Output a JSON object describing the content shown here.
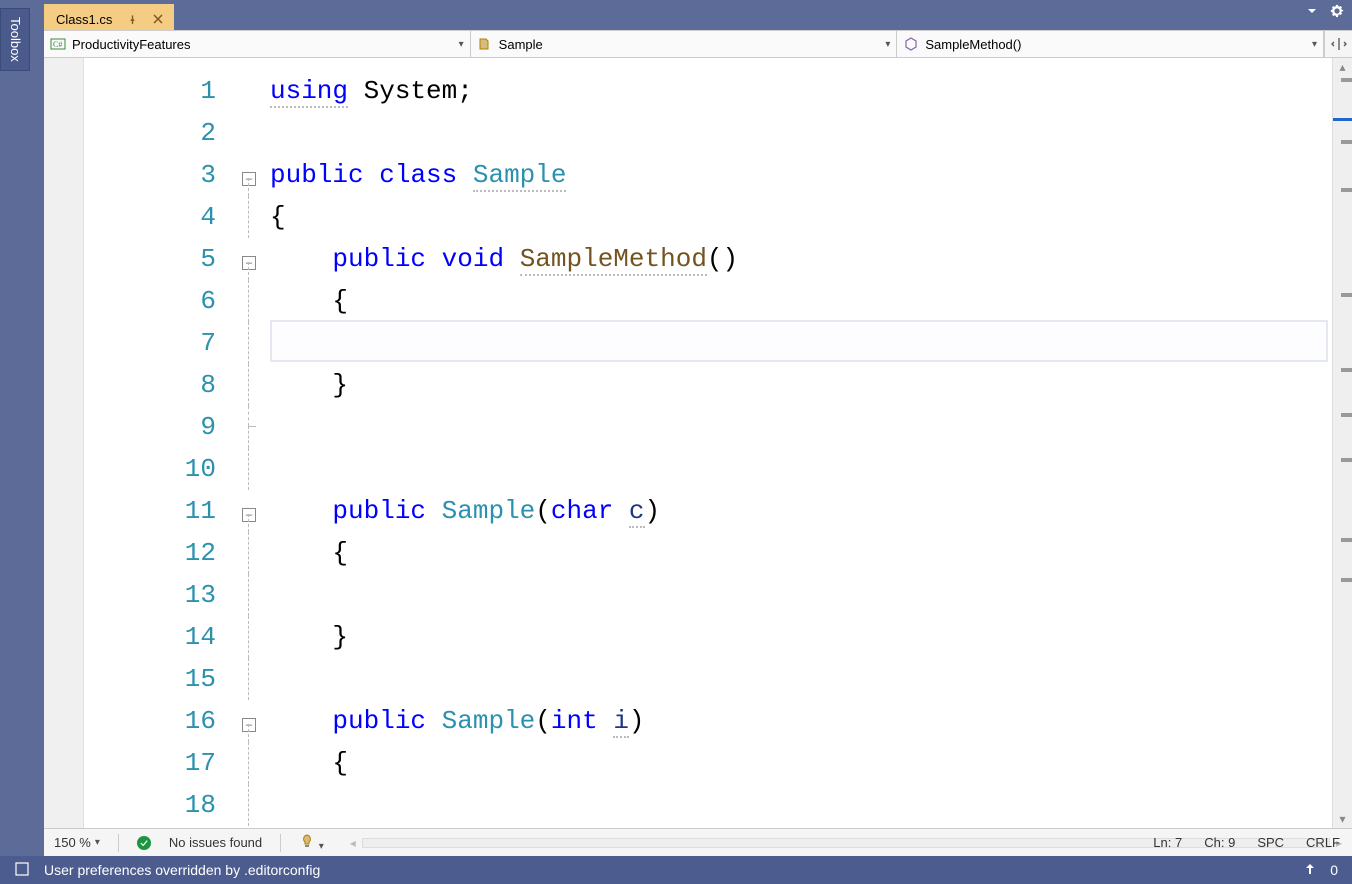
{
  "toolbox_label": "Toolbox",
  "tab": {
    "filename": "Class1.cs"
  },
  "nav": {
    "namespace": "ProductivityFeatures",
    "class": "Sample",
    "member": "SampleMethod()"
  },
  "code": {
    "line_count": 18,
    "current_line_index": 6,
    "lines": [
      {
        "n": 1,
        "fold": "",
        "tokens": [
          [
            "kw dotted",
            "using"
          ],
          [
            "",
            " "
          ],
          [
            "",
            "System;"
          ]
        ]
      },
      {
        "n": 2,
        "fold": "",
        "tokens": []
      },
      {
        "n": 3,
        "fold": "box",
        "tokens": [
          [
            "kw",
            "public"
          ],
          [
            "",
            " "
          ],
          [
            "kw",
            "class"
          ],
          [
            "",
            " "
          ],
          [
            "type dotted",
            "Sample"
          ]
        ]
      },
      {
        "n": 4,
        "fold": "line",
        "tokens": [
          [
            "",
            "{"
          ]
        ]
      },
      {
        "n": 5,
        "fold": "box",
        "tokens": [
          [
            "",
            "    "
          ],
          [
            "kw",
            "public"
          ],
          [
            "",
            " "
          ],
          [
            "kw",
            "void"
          ],
          [
            "",
            " "
          ],
          [
            "call dotted",
            "SampleMethod"
          ],
          [
            "",
            "()"
          ]
        ]
      },
      {
        "n": 6,
        "fold": "line",
        "tokens": [
          [
            "",
            "    {"
          ]
        ]
      },
      {
        "n": 7,
        "fold": "line",
        "tokens": [
          [
            "",
            "        "
          ],
          [
            "cursor",
            ""
          ]
        ]
      },
      {
        "n": 8,
        "fold": "line",
        "tokens": [
          [
            "",
            "    }"
          ]
        ]
      },
      {
        "n": 9,
        "fold": "cap",
        "tokens": []
      },
      {
        "n": 10,
        "fold": "line",
        "tokens": []
      },
      {
        "n": 11,
        "fold": "box",
        "tokens": [
          [
            "",
            "    "
          ],
          [
            "kw",
            "public"
          ],
          [
            "",
            " "
          ],
          [
            "type",
            "Sample"
          ],
          [
            "",
            "("
          ],
          [
            "kw",
            "char"
          ],
          [
            "",
            " "
          ],
          [
            "ident dotted",
            "c"
          ],
          [
            "",
            ")"
          ]
        ]
      },
      {
        "n": 12,
        "fold": "line",
        "tokens": [
          [
            "",
            "    {"
          ]
        ]
      },
      {
        "n": 13,
        "fold": "line",
        "tokens": []
      },
      {
        "n": 14,
        "fold": "line",
        "tokens": [
          [
            "",
            "    }"
          ]
        ]
      },
      {
        "n": 15,
        "fold": "line",
        "tokens": []
      },
      {
        "n": 16,
        "fold": "box",
        "tokens": [
          [
            "",
            "    "
          ],
          [
            "kw",
            "public"
          ],
          [
            "",
            " "
          ],
          [
            "type",
            "Sample"
          ],
          [
            "",
            "("
          ],
          [
            "kw",
            "int"
          ],
          [
            "",
            " "
          ],
          [
            "ident dotted",
            "i"
          ],
          [
            "",
            ")"
          ]
        ]
      },
      {
        "n": 17,
        "fold": "line",
        "tokens": [
          [
            "",
            "    {"
          ]
        ]
      },
      {
        "n": 18,
        "fold": "line",
        "tokens": []
      }
    ]
  },
  "editor_status": {
    "zoom": "150 %",
    "issues": "No issues found",
    "ln_label": "Ln:",
    "ln": "7",
    "ch_label": "Ch:",
    "ch": "9",
    "spaces": "SPC",
    "lineend": "CRLF"
  },
  "vs_status": {
    "message": "User preferences overridden by .editorconfig",
    "count": "0"
  }
}
